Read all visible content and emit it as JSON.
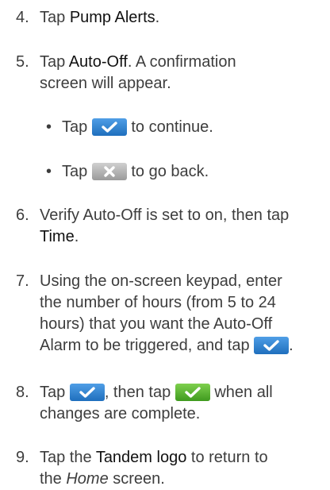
{
  "steps": [
    {
      "num": "4.",
      "pre": "Tap ",
      "bold": "Pump Alerts",
      "post": "."
    },
    {
      "num": "5.",
      "pre": "Tap ",
      "bold": "Auto-Off",
      "post": ". A confirmation",
      "line2": "screen will appear."
    },
    {
      "num": "6.",
      "line1": "Verify Auto-Off is set to on, then tap",
      "bold": "Time",
      "post": "."
    },
    {
      "num": "7.",
      "line1": "Using the on-screen keypad, enter",
      "line2": "the number of hours (from 5 to 24",
      "line3": "hours) that you want the Auto-Off",
      "line4": "Alarm to be triggered, and tap",
      "post": "."
    },
    {
      "num": "8.",
      "pre": "Tap",
      "mid": ", then tap",
      "post": "when all",
      "line2": "changes are complete."
    },
    {
      "num": "9.",
      "pre": "Tap the ",
      "bold": "Tandem logo",
      "post": " to return to",
      "line2_pre": "the ",
      "line2_italic": "Home",
      "line2_post": " screen."
    }
  ],
  "bullets": [
    {
      "dot": "•",
      "pre": "Tap",
      "post": "to continue.",
      "icon": "checkmark-icon"
    },
    {
      "dot": "•",
      "pre": "Tap",
      "post": "to go back.",
      "icon": "close-icon"
    }
  ],
  "colors": {
    "blue_button": "#2f86d6",
    "green_button": "#5bb832",
    "grey_button": "#b5b5b5"
  }
}
